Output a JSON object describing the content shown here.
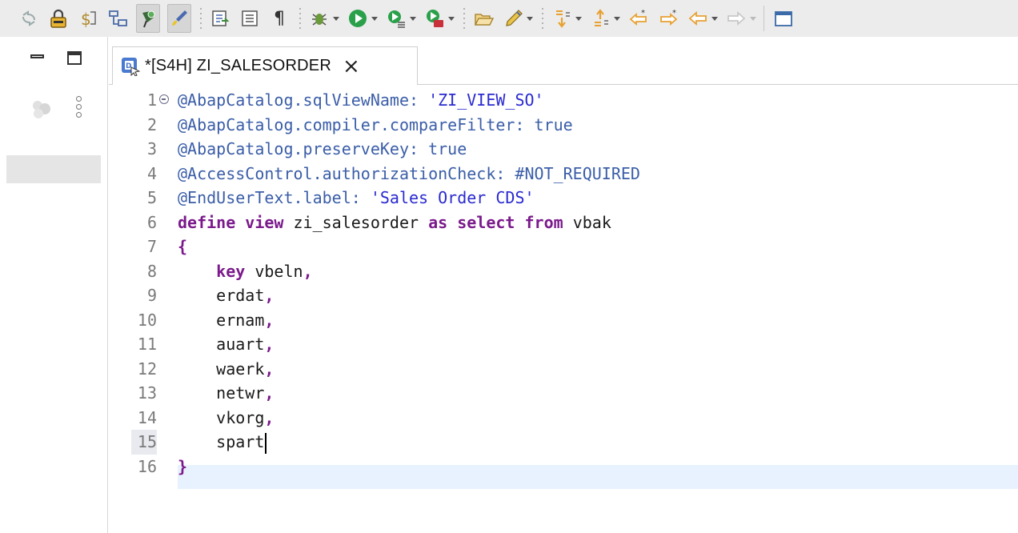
{
  "toolbar": {
    "icons": [
      "refresh-icon",
      "lock-icon",
      "dollar-icon",
      "tree-icon",
      "pin-icon",
      "brush-icon",
      "export-icon",
      "list-icon",
      "pilcrow-icon",
      "debug-icon",
      "run-icon",
      "run-config-icon",
      "external-tools-icon",
      "open-folder-icon",
      "pencil-icon",
      "next-annotation-icon",
      "prev-annotation-icon",
      "last-edit-icon",
      "back-icon",
      "forward-icon",
      "window-icon"
    ],
    "pilcrow": "¶"
  },
  "tab": {
    "title": "*[S4H] ZI_SALESORDER",
    "close": "×"
  },
  "editor": {
    "current_line": 15,
    "lines": [
      {
        "n": "1",
        "parts": [
          {
            "t": "@AbapCatalog.sqlViewName: ",
            "c": "anno"
          },
          {
            "t": "'ZI_VIEW_SO'",
            "c": "str"
          }
        ]
      },
      {
        "n": "2",
        "parts": [
          {
            "t": "@AbapCatalog.compiler.compareFilter: true",
            "c": "anno"
          }
        ]
      },
      {
        "n": "3",
        "parts": [
          {
            "t": "@AbapCatalog.preserveKey: true",
            "c": "anno"
          }
        ]
      },
      {
        "n": "4",
        "parts": [
          {
            "t": "@AccessControl.authorizationCheck: #NOT_REQUIRED",
            "c": "anno"
          }
        ]
      },
      {
        "n": "5",
        "parts": [
          {
            "t": "@EndUserText.label: ",
            "c": "anno"
          },
          {
            "t": "'Sales Order CDS'",
            "c": "str"
          }
        ]
      },
      {
        "n": "6",
        "parts": [
          {
            "t": "define view ",
            "c": "kw"
          },
          {
            "t": "zi_salesorder ",
            "c": "plain"
          },
          {
            "t": "as select from ",
            "c": "kw"
          },
          {
            "t": "vbak",
            "c": "plain"
          }
        ]
      },
      {
        "n": "7",
        "parts": [
          {
            "t": "{",
            "c": "kw"
          }
        ]
      },
      {
        "n": "8",
        "parts": [
          {
            "t": "    ",
            "c": "plain"
          },
          {
            "t": "key ",
            "c": "kw"
          },
          {
            "t": "vbeln",
            "c": "plain"
          },
          {
            "t": ",",
            "c": "kw"
          }
        ]
      },
      {
        "n": "9",
        "parts": [
          {
            "t": "    erdat",
            "c": "plain"
          },
          {
            "t": ",",
            "c": "kw"
          }
        ]
      },
      {
        "n": "10",
        "parts": [
          {
            "t": "    ernam",
            "c": "plain"
          },
          {
            "t": ",",
            "c": "kw"
          }
        ]
      },
      {
        "n": "11",
        "parts": [
          {
            "t": "    auart",
            "c": "plain"
          },
          {
            "t": ",",
            "c": "kw"
          }
        ]
      },
      {
        "n": "12",
        "parts": [
          {
            "t": "    waerk",
            "c": "plain"
          },
          {
            "t": ",",
            "c": "kw"
          }
        ]
      },
      {
        "n": "13",
        "parts": [
          {
            "t": "    netwr",
            "c": "plain"
          },
          {
            "t": ",",
            "c": "kw"
          }
        ]
      },
      {
        "n": "14",
        "parts": [
          {
            "t": "    vkorg",
            "c": "plain"
          },
          {
            "t": ",",
            "c": "kw"
          }
        ]
      },
      {
        "n": "15",
        "parts": [
          {
            "t": "    spart",
            "c": "plain"
          }
        ]
      },
      {
        "n": "16",
        "parts": [
          {
            "t": "}",
            "c": "kw"
          }
        ]
      }
    ]
  },
  "colors": {
    "annotation": "#3b5ea8",
    "string": "#2a2ad0",
    "keyword": "#7b1a8c",
    "current_line": "#e8f2fe"
  }
}
